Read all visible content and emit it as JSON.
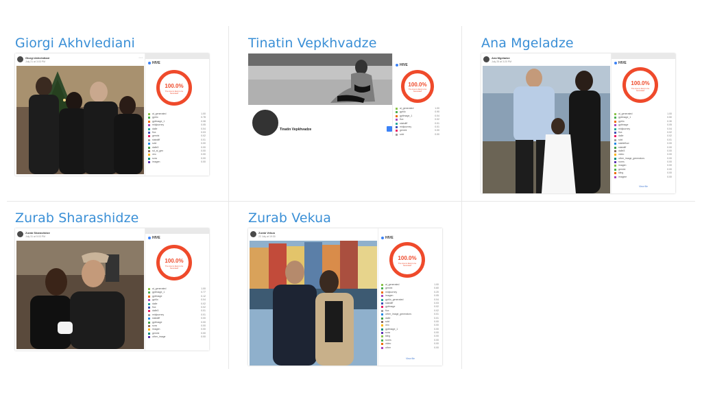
{
  "colors": {
    "name": "#3a8fd6",
    "ring": "#ef4a2b",
    "swatches": [
      "#8bc34a",
      "#4caf50",
      "#ef6c00",
      "#ab47bc",
      "#26a69a",
      "#3f51b5",
      "#e91e63",
      "#9e9e9e",
      "#1e88e5",
      "#43a047",
      "#8d6e63",
      "#ffb300",
      "#00897b",
      "#5e35b1"
    ]
  },
  "hive": {
    "logo": "HIVE",
    "percent": "100.0%",
    "sub": "The input is likely to be Generated",
    "view_file": "View file"
  },
  "cells": [
    {
      "name": "Giorgi Akhvlediani",
      "poster": "Giorgi Akhvlediani",
      "date": "July 21 at 3:03 PM",
      "labels": [
        "ai_generated",
        "gpt4o",
        "gptimage_1",
        "midjourney",
        "dalle",
        "flux",
        "gemini",
        "stabdiff",
        "sdxl",
        "dalle3",
        "sd_ai_gen",
        "veo",
        "sora",
        "imagen"
      ],
      "values": [
        "1.00",
        "0.78",
        "0.08",
        "0.05",
        "0.04",
        "0.03",
        "0.02",
        "0.01",
        "0.00",
        "0.00",
        "0.00",
        "0.00",
        "0.00",
        "0.00"
      ]
    },
    {
      "name": "Tinatin Vepkhvadze",
      "poster": "Tinatin Vepkhvadze",
      "labels": [
        "ai_generated",
        "gpt4o",
        "gptimage_1",
        "flux",
        "stabdiff",
        "midjourney",
        "gemini",
        "sdxl",
        "veo"
      ],
      "values": [
        "1.00",
        "0.90",
        "0.04",
        "0.02",
        "0.01",
        "0.01",
        "0.00",
        "0.00",
        "0.00"
      ]
    },
    {
      "name": "Ana Mgeladze",
      "poster": "Ana Mgeladze",
      "date": "July 25 at 3:20 PM",
      "labels": [
        "ai_generated",
        "gptimage_1",
        "gpt4o",
        "gptimage",
        "midjourney",
        "flux",
        "dalle",
        "sdxl",
        "stableflow",
        "stabdiff",
        "dalle3",
        "video",
        "other_image_generators",
        "runes",
        "imagen",
        "gemini",
        "kling",
        "imagine"
      ],
      "values": [
        "1.00",
        "0.50",
        "0.30",
        "0.05",
        "0.04",
        "0.02",
        "0.02",
        "0.01",
        "0.00",
        "0.00",
        "0.00",
        "0.00",
        "0.00",
        "0.00",
        "0.00",
        "0.00",
        "0.00",
        "0.00"
      ]
    },
    {
      "name": "Zurab Sharashidze",
      "poster": "Zurab Sharashidze",
      "date": "July 31 at 5:03 PM",
      "labels": [
        "ai_generated",
        "gptimage_1",
        "gptimage",
        "gpt4o",
        "dalle",
        "flux",
        "dalle3",
        "midjourney",
        "stabdiff",
        "gptimage",
        "sora",
        "imagen",
        "gemini",
        "other_image"
      ],
      "values": [
        "1.00",
        "0.77",
        "0.12",
        "0.04",
        "0.02",
        "0.02",
        "0.01",
        "0.01",
        "0.00",
        "0.00",
        "0.00",
        "0.00",
        "0.00",
        "0.00"
      ]
    },
    {
      "name": "Zurab Vekua",
      "poster": "Zurab Vekua",
      "date": "22 July at 19:30",
      "labels": [
        "ai_generated",
        "gemini",
        "midjourney",
        "imagen",
        "gpt4o_generated",
        "stabdiff",
        "gptimage",
        "flux",
        "other_image_generators",
        "dalle",
        "sdxl",
        "veo",
        "gptimage_1",
        "sora",
        "kling",
        "runes",
        "video",
        "other"
      ],
      "values": [
        "1.00",
        "0.60",
        "0.20",
        "0.05",
        "0.04",
        "0.03",
        "0.02",
        "0.02",
        "0.01",
        "0.01",
        "0.00",
        "0.00",
        "0.00",
        "0.00",
        "0.00",
        "0.00",
        "0.00",
        "0.00"
      ]
    }
  ]
}
